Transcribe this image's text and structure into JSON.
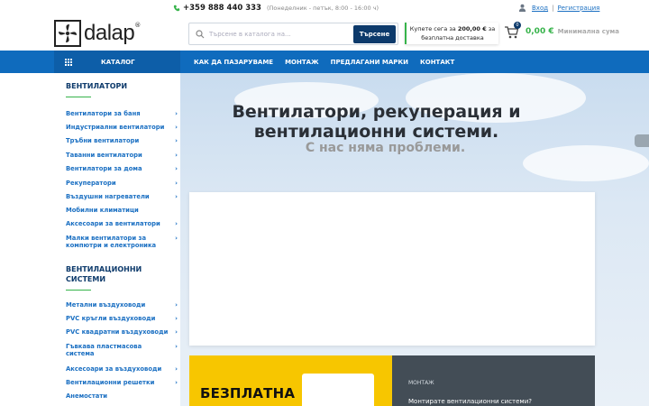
{
  "topbar": {
    "phone": "+359 888 440 333",
    "hours": "(Понеделник - петък, 8:00 - 16:00 ч)",
    "login": "Вход",
    "register": "Регистрация"
  },
  "header": {
    "logo_text": "dalap",
    "logo_mark": "®",
    "search_placeholder": "Търсене в каталога на...",
    "search_button": "Търсене",
    "free_shipping_line1_pre": "Купете сега за ",
    "free_shipping_amount": "200,00 €",
    "free_shipping_line1_post": " за",
    "free_shipping_line2": "безплатна доставка",
    "cart_count": "0",
    "cart_amount": "0,00 €",
    "cart_min": "Минимална сума"
  },
  "nav": {
    "catalog": "КАТАЛОГ",
    "links": [
      "КАК ДА ПАЗАРУВАМЕ",
      "МОНТАЖ",
      "ПРЕДЛАГАНИ МАРКИ",
      "КОНТАКТ"
    ]
  },
  "sidebar": {
    "section1_title": "ВЕНТИЛАТОРИ",
    "section1_items": [
      "Вентилатори за баня",
      "Индустриални вентилатори",
      "Тръбни вентилатори",
      "Таванни вентилатори",
      "Вентилатори за дома",
      "Рекуператори",
      "Въздушни нагреватели",
      "Мобилни климатици",
      "Аксесоари за вентилатори",
      "Малки вентилатори за компютри и електроника"
    ],
    "section2_title_line1": "ВЕНТИЛАЦИОННИ",
    "section2_title_line2": "СИСТЕМИ",
    "section2_items": [
      "Метални въздуховоди",
      "PVC кръгли въздуховоди",
      "PVC квадратни въздуховоди",
      "Гъвкава пластмасова система",
      "Аксесоари за въздуховоди",
      "Вентилационни решетки",
      "Анемостати"
    ]
  },
  "hero": {
    "title_line1": "Вентилатори, рекуперация и",
    "title_line2": "вентилационни системи.",
    "subtitle": "С нас няма проблеми."
  },
  "promo": {
    "yellow_title": "БЕЗПЛАТНА",
    "dark_label": "МОНТАЖ",
    "dark_text": "Монтирате вентилационни системи?"
  },
  "colors": {
    "nav_blue": "#0f6bbd",
    "dark_blue": "#0d3a6b",
    "green": "#36b34a",
    "link_blue": "#1a6fc2",
    "promo_yellow": "#f7c600"
  }
}
